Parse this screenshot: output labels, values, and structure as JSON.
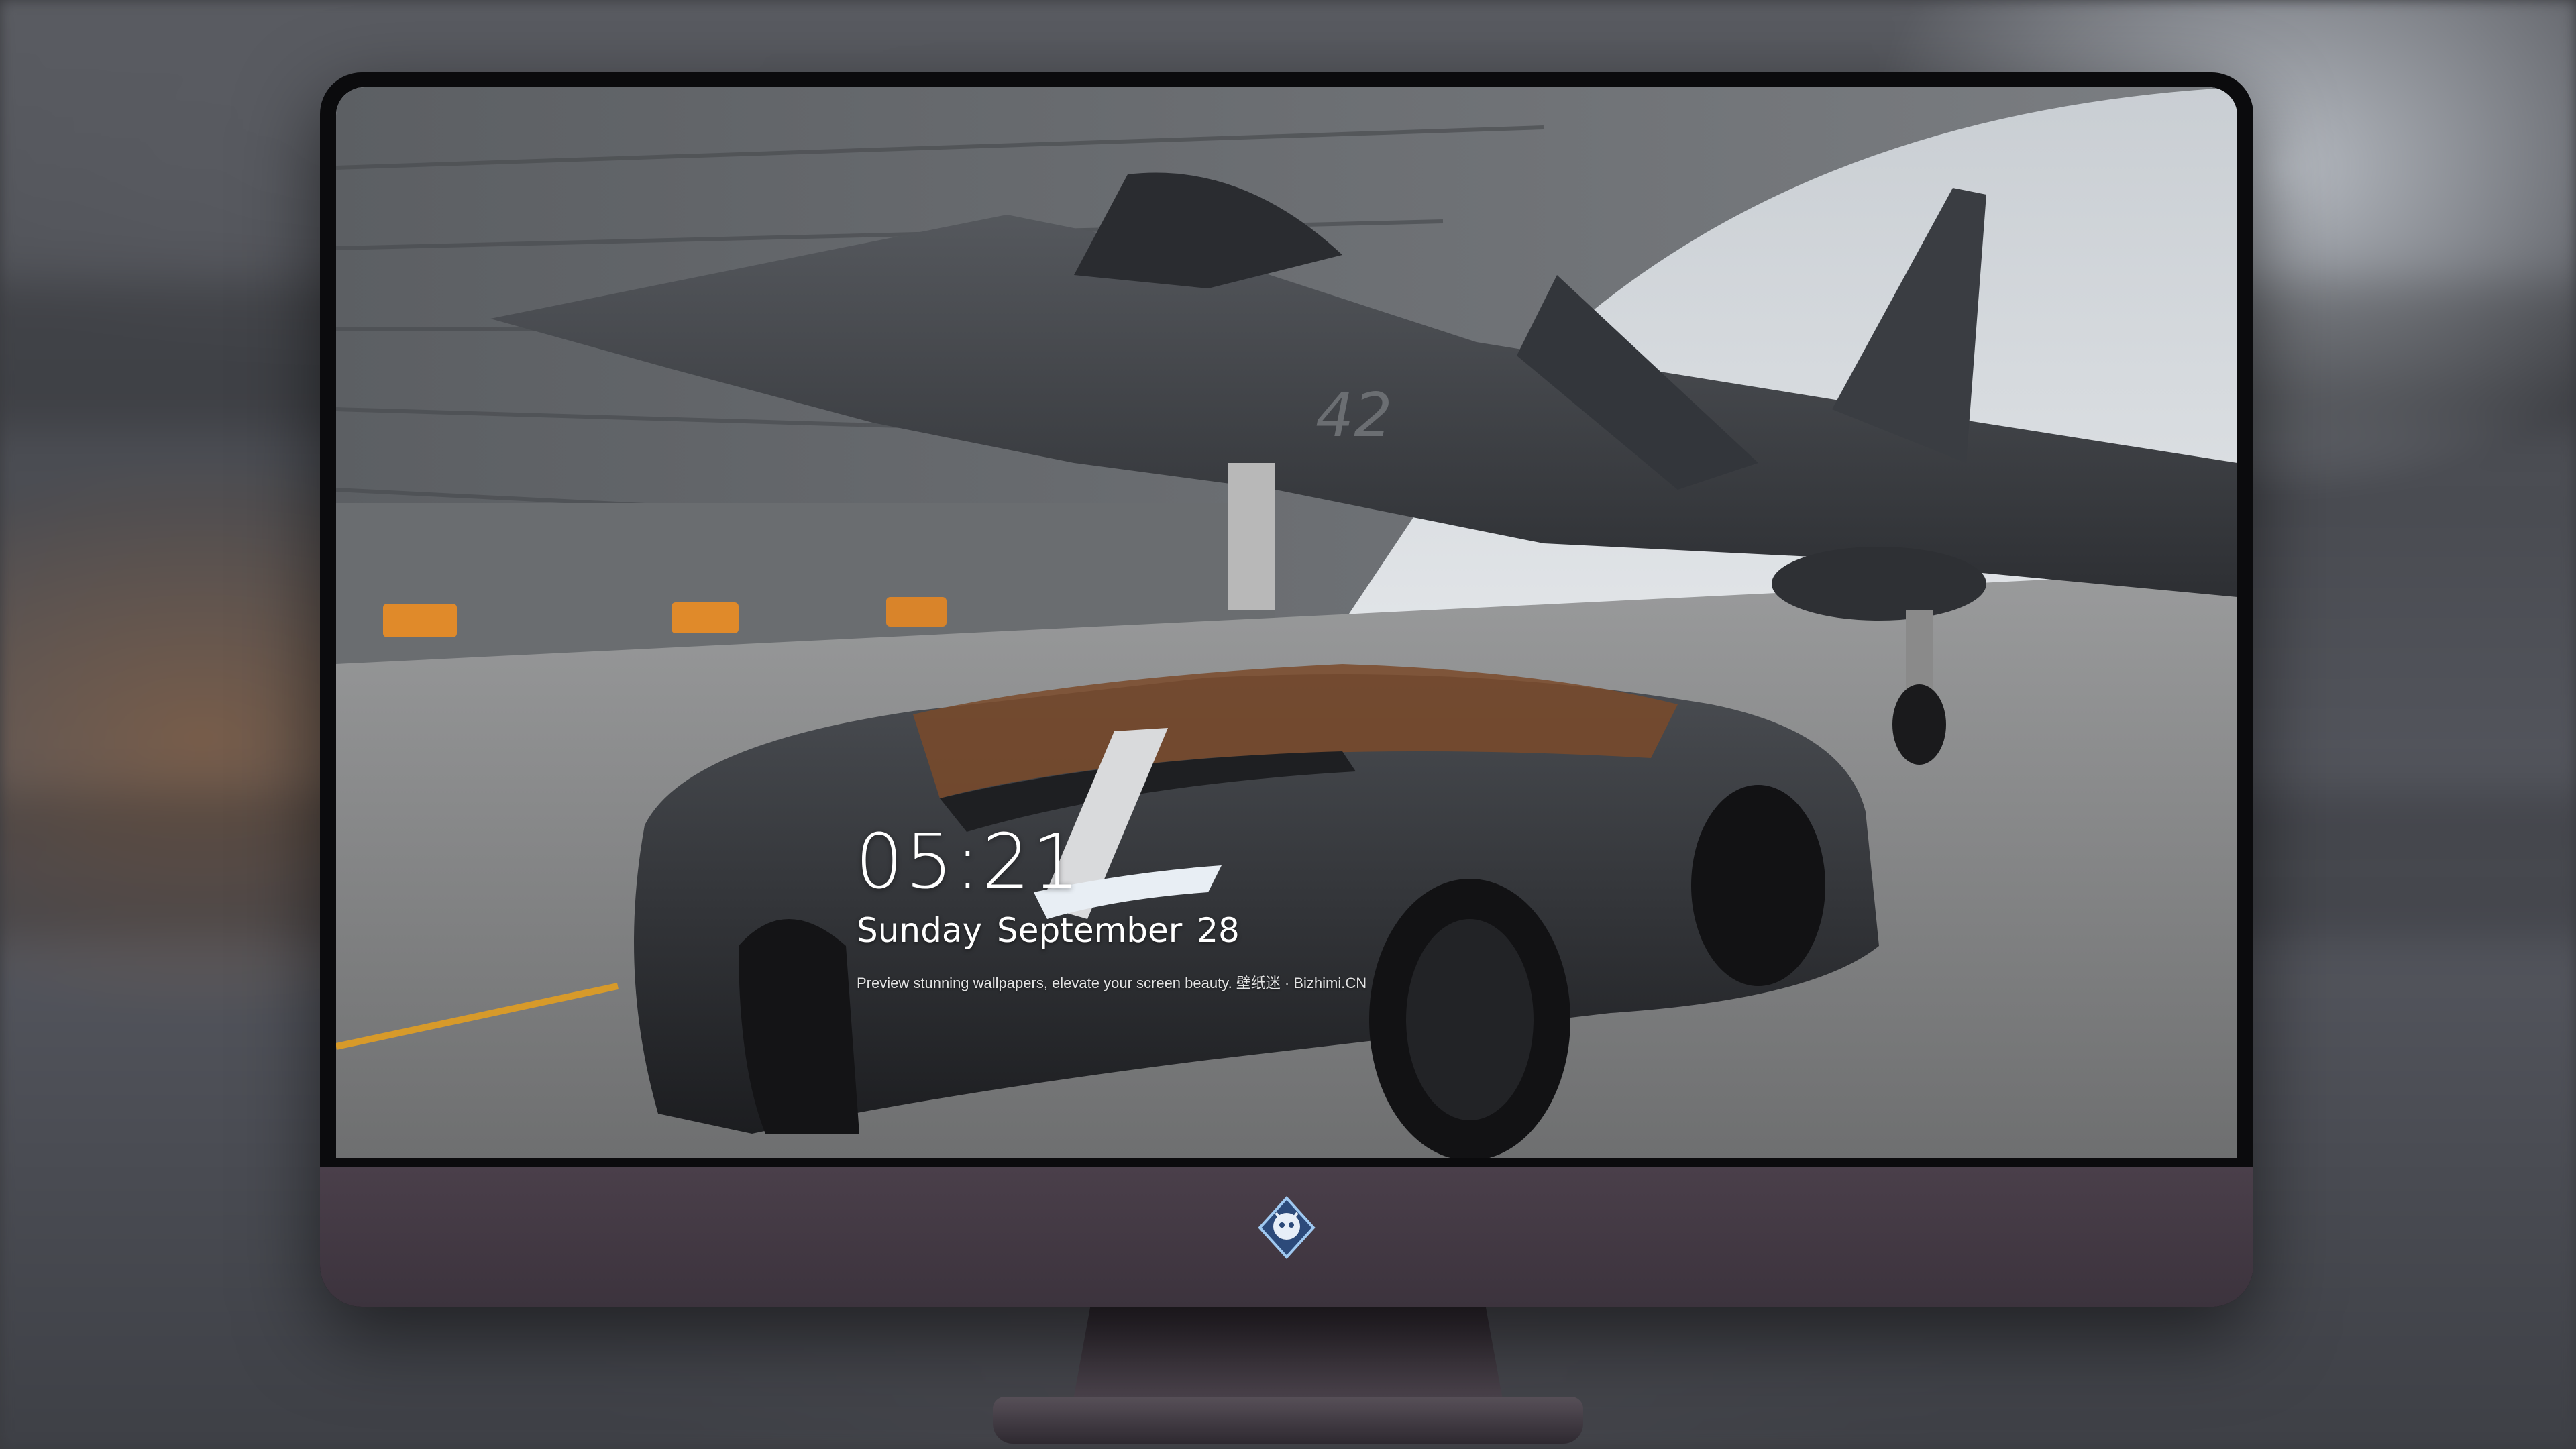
{
  "lock_screen": {
    "time": "05:21",
    "date": "Sunday September  28",
    "caption": "Preview stunning wallpapers, elevate your screen beauty. 壁纸迷 · Bizhimi.CN"
  },
  "dock": {
    "apps": [
      {
        "name": "messages-icon",
        "color": "#34c759"
      },
      {
        "name": "weather-icon",
        "color": "#3b8ef0"
      },
      {
        "name": "clock-icon",
        "color": "#f2f2f2"
      },
      {
        "name": "preview-icon",
        "color": "#5aa0e8"
      },
      {
        "name": "clips-icon",
        "color": "#2db7e0"
      },
      {
        "name": "notes-icon",
        "color": "#ffd84a"
      },
      {
        "name": "photos-folder-icon",
        "color": "#9fd16a"
      },
      {
        "name": "music-icon",
        "color": "#fc5aa8"
      },
      {
        "name": "app-store-icon",
        "color": "#1e8cf6"
      },
      {
        "name": "camera-icon",
        "color": "#9a9a9a"
      }
    ]
  },
  "colors": {
    "monitor_chin": "#4a3f4a",
    "monitor_bezel": "#0b0b0d",
    "car_body": "#2b2d31",
    "jet_body": "#3c3f44"
  }
}
